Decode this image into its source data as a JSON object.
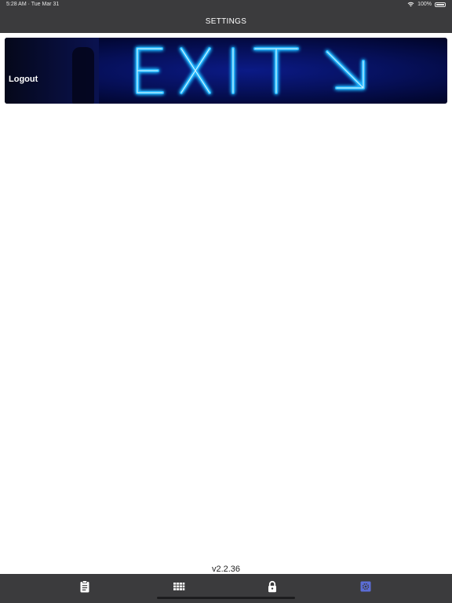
{
  "status_bar": {
    "time_date": "5:28 AM · Tue Mar 31",
    "battery": "100%"
  },
  "nav": {
    "title": "SETTINGS"
  },
  "banner": {
    "label": "Logout",
    "sign_text": "EXIT"
  },
  "footer": {
    "version": "v2.2.36"
  },
  "tabs": [
    {
      "icon": "clipboard-icon",
      "active": false
    },
    {
      "icon": "grid-icon",
      "active": false
    },
    {
      "icon": "lock-icon",
      "active": false
    },
    {
      "icon": "settings-gear-icon",
      "active": true
    }
  ],
  "colors": {
    "bar_bg": "#3b3b3d",
    "active_tab": "#5b6dd6",
    "inactive_tab": "#ffffff",
    "neon": "#23b6ff"
  }
}
